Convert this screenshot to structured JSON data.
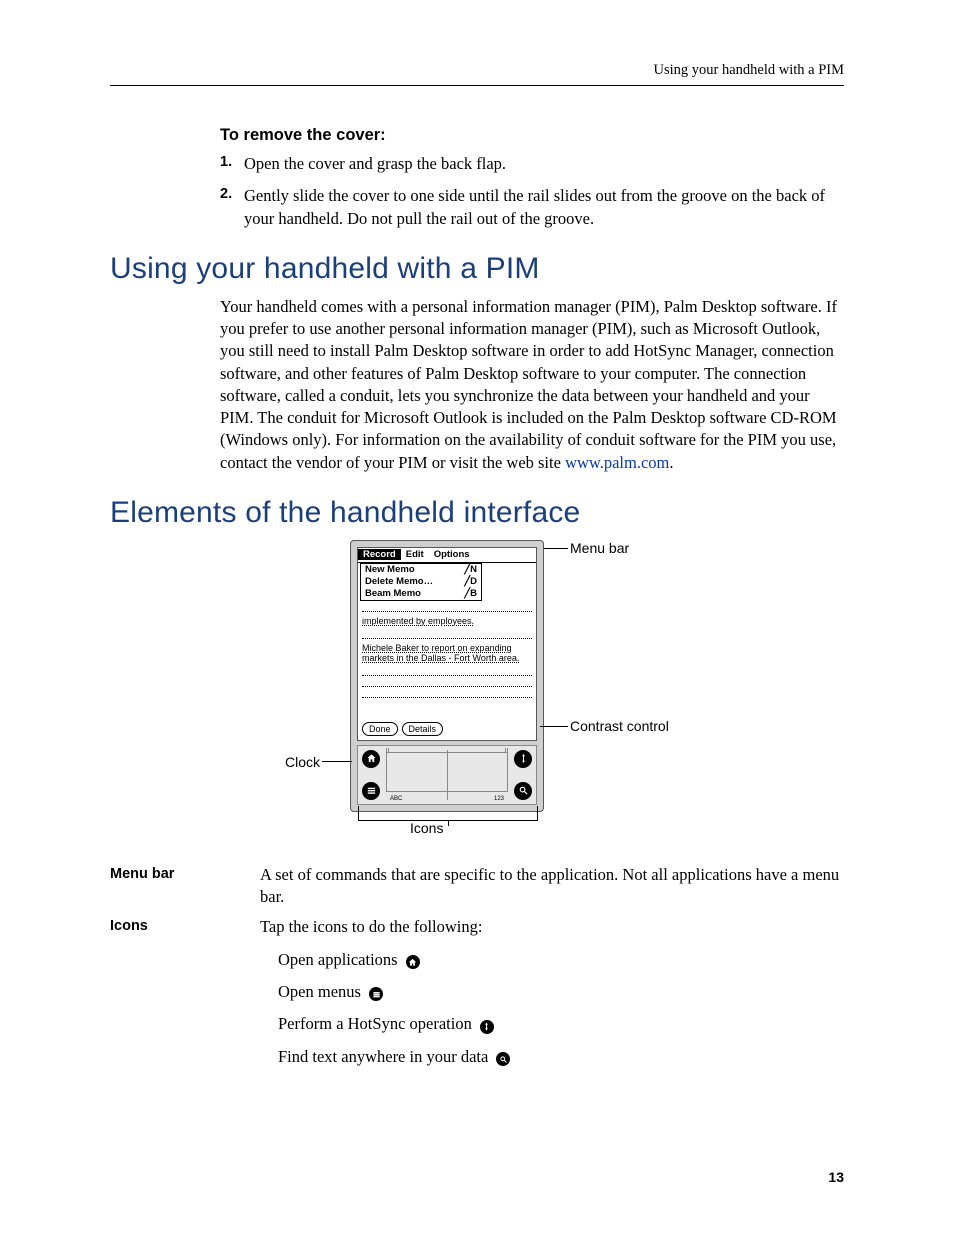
{
  "header": {
    "running": "Using your handheld with a PIM"
  },
  "cover": {
    "subhead": "To remove the cover:",
    "steps": [
      "Open the cover and grasp the back flap.",
      "Gently slide the cover to one side until the rail slides out from the groove on the back of your handheld. Do not pull the rail out of the groove."
    ]
  },
  "section_pim": {
    "title": "Using your handheld with a PIM",
    "body": "Your handheld comes with a personal information manager (PIM), Palm Desktop software. If you prefer to use another personal information manager (PIM), such as Microsoft Outlook, you still need to install Palm Desktop software in order to add HotSync Manager, connection software, and other features of Palm Desktop software to your computer. The connection software, called a conduit, lets you synchronize the data between your handheld and your PIM. The conduit for Microsoft Outlook is included on the Palm Desktop software CD-ROM (Windows only). For information on the availability of conduit software for the PIM you use, contact the vendor of your PIM or visit the web site ",
    "link_text": "www.palm.com",
    "body_end": "."
  },
  "section_elements": {
    "title": "Elements of the handheld interface"
  },
  "diagram": {
    "menubar": {
      "record": "Record",
      "edit": "Edit",
      "options": "Options"
    },
    "dropdown": [
      {
        "label": "New Memo",
        "cmd": "N"
      },
      {
        "label": "Delete Memo…",
        "cmd": "D"
      },
      {
        "label": "Beam Memo",
        "cmd": "B"
      }
    ],
    "memo_line1": "implemented by employees.",
    "memo_line2": "Michele Baker to report on expanding markets in the Dallas - Fort Worth area.",
    "buttons": {
      "done": "Done",
      "details": "Details"
    },
    "graffiti": {
      "abc": "ABC",
      "n123": "123"
    },
    "callouts": {
      "menubar": "Menu bar",
      "contrast": "Contrast control",
      "clock": "Clock",
      "icons": "Icons"
    }
  },
  "definitions": {
    "menubar": {
      "term": "Menu bar",
      "desc": "A set of commands that are specific to the application. Not all applications have a menu bar."
    },
    "icons": {
      "term": "Icons",
      "desc": "Tap the icons to do the following:",
      "items": [
        "Open applications",
        "Open menus",
        "Perform a HotSync operation",
        "Find text anywhere in your data"
      ]
    }
  },
  "page_number": "13"
}
